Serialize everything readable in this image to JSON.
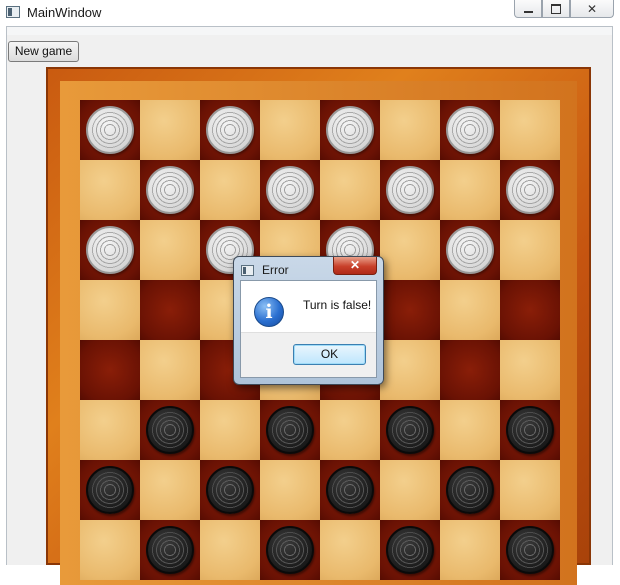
{
  "window": {
    "title": "MainWindow",
    "icon": "app-window-icon",
    "controls": {
      "minimize": "minimize-icon",
      "maximize": "maximize-icon",
      "close": "close-icon",
      "close_glyph": "✕"
    }
  },
  "toolbar": {
    "new_game_label": "New game"
  },
  "board": {
    "rows": 8,
    "cols": 8,
    "colors": {
      "light": "#eebf72",
      "dark": "#6a1204",
      "frame": "#d2691e"
    },
    "pieces": [
      [
        0,
        0,
        "white"
      ],
      [
        0,
        2,
        "white"
      ],
      [
        0,
        4,
        "white"
      ],
      [
        0,
        6,
        "white"
      ],
      [
        1,
        1,
        "white"
      ],
      [
        1,
        3,
        "white"
      ],
      [
        1,
        5,
        "white"
      ],
      [
        1,
        7,
        "white"
      ],
      [
        2,
        0,
        "white"
      ],
      [
        2,
        2,
        "white"
      ],
      [
        2,
        4,
        "white"
      ],
      [
        2,
        6,
        "white"
      ],
      [
        5,
        1,
        "black"
      ],
      [
        5,
        3,
        "black"
      ],
      [
        5,
        5,
        "black"
      ],
      [
        5,
        7,
        "black"
      ],
      [
        6,
        0,
        "black"
      ],
      [
        6,
        2,
        "black"
      ],
      [
        6,
        4,
        "black"
      ],
      [
        6,
        6,
        "black"
      ],
      [
        7,
        1,
        "black"
      ],
      [
        7,
        3,
        "black"
      ],
      [
        7,
        5,
        "black"
      ],
      [
        7,
        7,
        "black"
      ]
    ]
  },
  "dialog": {
    "title": "Error",
    "icon": "information-icon",
    "message": "Turn is false!",
    "ok_label": "OK",
    "close_glyph": "✕"
  }
}
